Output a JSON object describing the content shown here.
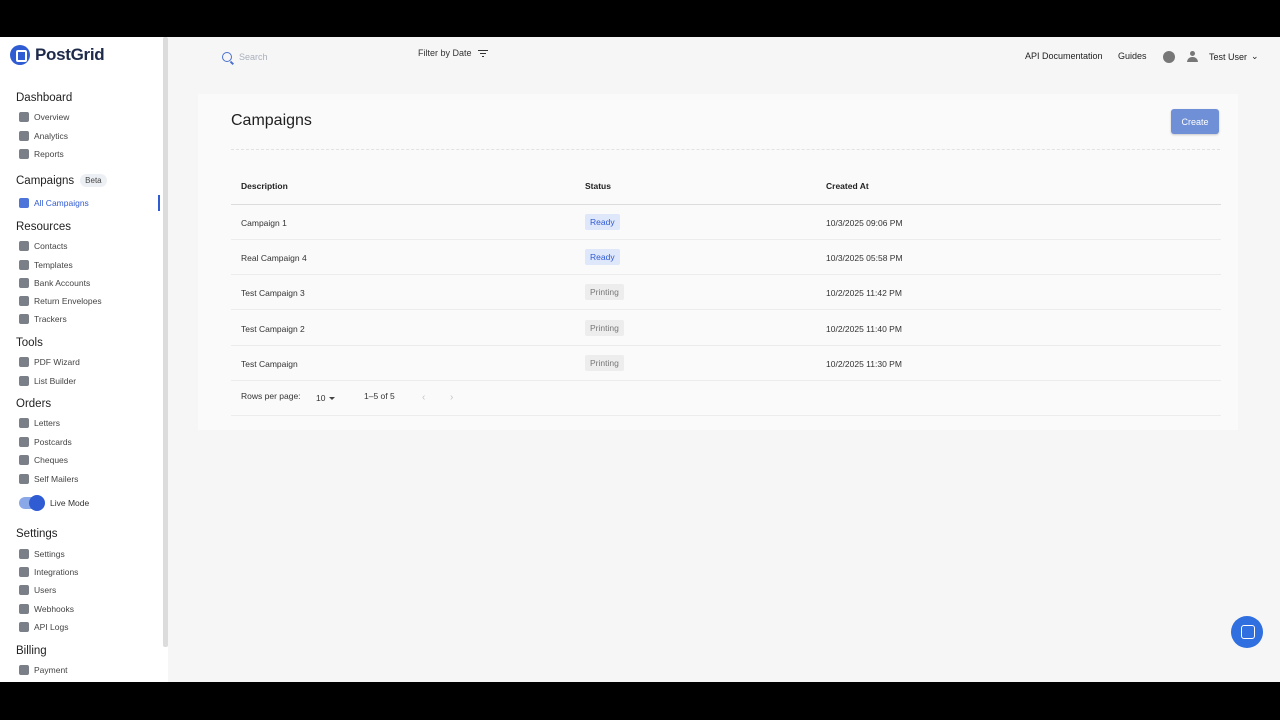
{
  "brand": {
    "name": "PostGrid"
  },
  "sidebar": {
    "sections": [
      {
        "label": "Dashboard",
        "items": [
          "Overview",
          "Analytics",
          "Reports"
        ]
      },
      {
        "label": "Campaigns",
        "badge": "Beta",
        "items": [
          "All Campaigns"
        ]
      },
      {
        "label": "Resources",
        "items": [
          "Contacts",
          "Templates",
          "Bank Accounts",
          "Return Envelopes",
          "Trackers"
        ]
      },
      {
        "label": "Tools",
        "items": [
          "PDF Wizard",
          "List Builder"
        ]
      },
      {
        "label": "Orders",
        "items": [
          "Letters",
          "Postcards",
          "Cheques",
          "Self Mailers"
        ]
      },
      {
        "label": "Settings",
        "items": [
          "Settings",
          "Integrations",
          "Users",
          "Webhooks",
          "API Logs"
        ]
      },
      {
        "label": "Billing",
        "items": [
          "Payment"
        ]
      }
    ],
    "live_mode_label": "Live Mode",
    "live_mode_on": true
  },
  "topbar": {
    "search_placeholder": "Search",
    "filter_label": "Filter by Date",
    "api_docs": "API Documentation",
    "guides": "Guides",
    "user_name": "Test User"
  },
  "main": {
    "title": "Campaigns",
    "create_label": "Create",
    "columns": [
      "Description",
      "Status",
      "Created At"
    ],
    "rows": [
      {
        "description": "Campaign 1",
        "status": "Ready",
        "created_at": "10/3/2025 09:06 PM"
      },
      {
        "description": "Real Campaign 4",
        "status": "Ready",
        "created_at": "10/3/2025 05:58 PM"
      },
      {
        "description": "Test Campaign 3",
        "status": "Printing",
        "created_at": "10/2/2025 11:42 PM"
      },
      {
        "description": "Test Campaign 2",
        "status": "Printing",
        "created_at": "10/2/2025 11:40 PM"
      },
      {
        "description": "Test Campaign",
        "status": "Printing",
        "created_at": "10/2/2025 11:30 PM"
      }
    ],
    "pagination": {
      "rows_per_page_label": "Rows per page:",
      "rows_per_page": "10",
      "range": "1–5 of 5"
    }
  },
  "colors": {
    "accent": "#2f5bd3",
    "ready_bg": "#dfe7fa",
    "printing_bg": "#ededed"
  }
}
